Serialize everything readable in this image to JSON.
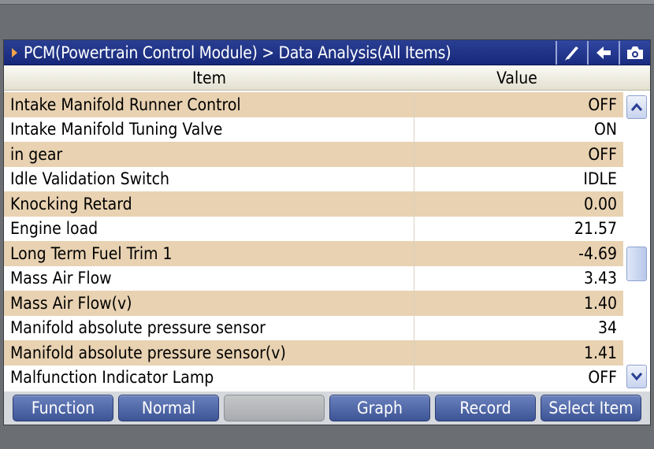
{
  "header": {
    "breadcrumb": "PCM(Powertrain Control Module) > Data Analysis(All Items)",
    "tools": [
      "edit-icon",
      "back-icon",
      "camera-icon"
    ]
  },
  "table": {
    "columns": {
      "item": "Item",
      "value": "Value"
    },
    "rows": [
      {
        "item": "Intake Manifold Runner Control",
        "value": "OFF"
      },
      {
        "item": "Intake Manifold Tuning Valve",
        "value": "ON"
      },
      {
        "item": "in gear",
        "value": "OFF"
      },
      {
        "item": "Idle Validation Switch",
        "value": "IDLE"
      },
      {
        "item": "Knocking Retard",
        "value": "0.00"
      },
      {
        "item": "Engine load",
        "value": "21.57"
      },
      {
        "item": "Long Term Fuel Trim 1",
        "value": "-4.69"
      },
      {
        "item": "Mass Air Flow",
        "value": "3.43"
      },
      {
        "item": "Mass Air Flow(v)",
        "value": "1.40"
      },
      {
        "item": "Manifold absolute pressure sensor",
        "value": "34"
      },
      {
        "item": "Manifold absolute pressure sensor(v)",
        "value": "1.41"
      },
      {
        "item": "Malfunction Indicator Lamp",
        "value": "OFF"
      }
    ]
  },
  "buttons": {
    "function": "Function",
    "normal": "Normal",
    "blank": "",
    "graph": "Graph",
    "record": "Record",
    "select_item": "Select Item"
  },
  "colors": {
    "title_bar": "#1f3388",
    "row_tan": "#e8d2b2",
    "button_blue": "#536bab",
    "accent_orange": "#f3a54a"
  }
}
